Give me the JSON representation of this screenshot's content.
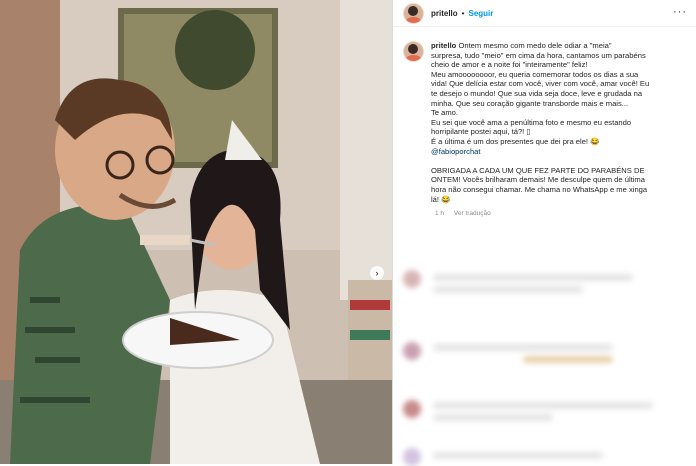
{
  "post": {
    "username": "pritello",
    "separator": "•",
    "follow_label": "Seguir",
    "more_label": "···",
    "next_label": "›"
  },
  "caption": {
    "username": "pritello",
    "l1": " Ontem mesmo com medo dele odiar a \"meia\"",
    "l2": "surpresa, tudo \"meio\" em cima da hora, cantamos um parabéns",
    "l3": "cheio de amor e a noite foi \"inteiramente\" feliz!",
    "l4": "Meu amoooooooor, eu queria comemorar todos os dias a sua",
    "l5": "vida! Que delícia estar com você, viver com você, amar você! Eu",
    "l6": "te desejo o mundo! Que sua vida seja doce, leve e grudada na",
    "l7": "minha. Que seu coração gigante transborde mais e mais...",
    "l8": "Te amo.",
    "l9": "Eu sei que você ama a penúltima foto e mesmo eu estando",
    "l10": "horripilante postei aqui, tá?! ▯",
    "l11": "É a última é um dos presentes que dei pra ele! 😂",
    "mention": "@fabioporchat",
    "l13": "OBRIGADA A CADA UM QUE FEZ PARTE DO PARABÉNS DE",
    "l14": "ONTEM! Vocês brilharam demais! Me desculpe quem de última",
    "l15": "hora não consegui chamar. Me chama no WhatsApp e me xinga",
    "l16": "lá! 😂"
  },
  "meta": {
    "time": "1 h",
    "translate": "Ver tradução"
  }
}
